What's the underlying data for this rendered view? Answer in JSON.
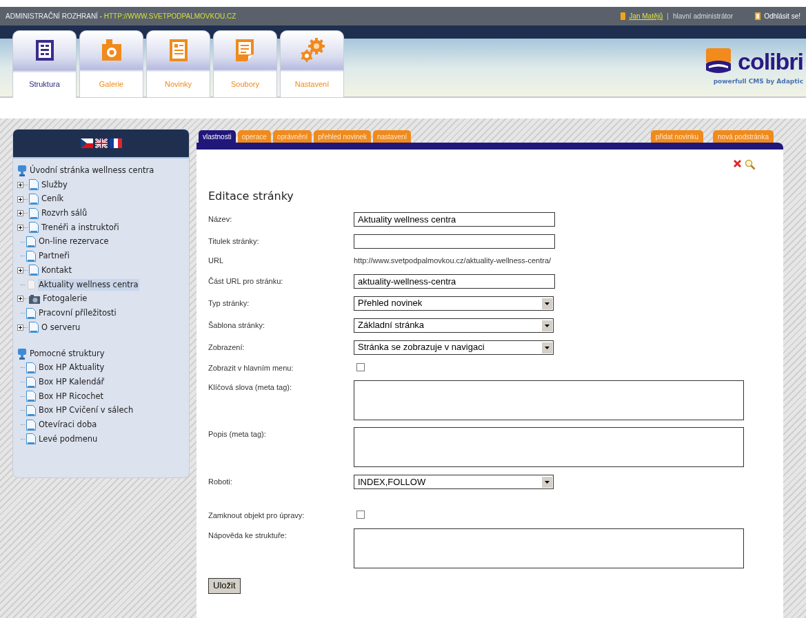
{
  "header": {
    "title": "ADMINISTRAČNÍ ROZHRANÍ - ",
    "site_url": "HTTP://WWW.SVETPODPALMOVKOU.CZ",
    "user": "Jan Matějů",
    "separator": "|",
    "role": "hlavní administrátor",
    "logout": "Odhlásit se!"
  },
  "modules": [
    {
      "label": "Struktura",
      "kind": "structure",
      "selected": true
    },
    {
      "label": "Galerie",
      "kind": "gallery",
      "selected": false
    },
    {
      "label": "Novinky",
      "kind": "news",
      "selected": false
    },
    {
      "label": "Soubory",
      "kind": "files",
      "selected": false
    },
    {
      "label": "Nastavení",
      "kind": "settings",
      "selected": false
    }
  ],
  "logo": {
    "name": "colibri",
    "tagline": "powerfull CMS by Adaptic"
  },
  "languages": [
    {
      "kind": "cz"
    },
    {
      "kind": "uk"
    },
    {
      "kind": "fr"
    }
  ],
  "tree": {
    "sections": [
      {
        "label": "Úvodní stránka wellness centra",
        "children": [
          {
            "label": "Služby",
            "kind": "page",
            "expandable": true,
            "selected": false
          },
          {
            "label": "Ceník",
            "kind": "page",
            "expandable": true,
            "selected": false
          },
          {
            "label": "Rozvrh sálů",
            "kind": "page",
            "expandable": true,
            "selected": false
          },
          {
            "label": "Trenéři a instruktoři",
            "kind": "page",
            "expandable": true,
            "selected": false
          },
          {
            "label": "On-line rezervace",
            "kind": "page",
            "expandable": false,
            "selected": false
          },
          {
            "label": "Partneři",
            "kind": "page",
            "expandable": false,
            "selected": false
          },
          {
            "label": "Kontakt",
            "kind": "page",
            "expandable": true,
            "selected": false
          },
          {
            "label": "Aktuality wellness centra",
            "kind": "news",
            "expandable": false,
            "selected": true
          },
          {
            "label": "Fotogalerie",
            "kind": "gallery",
            "expandable": true,
            "selected": false
          },
          {
            "label": "Pracovní příležitosti",
            "kind": "page",
            "expandable": false,
            "selected": false
          },
          {
            "label": "O serveru",
            "kind": "page",
            "expandable": true,
            "selected": false
          }
        ]
      },
      {
        "label": "Pomocné struktury",
        "children": [
          {
            "label": "Box HP Aktuality",
            "kind": "page",
            "expandable": false,
            "selected": false
          },
          {
            "label": "Box HP Kalendář",
            "kind": "page",
            "expandable": false,
            "selected": false
          },
          {
            "label": "Box HP Ricochet",
            "kind": "page",
            "expandable": false,
            "selected": false
          },
          {
            "label": "Box HP Cvičení v sálech",
            "kind": "page",
            "expandable": false,
            "selected": false
          },
          {
            "label": "Otevíraci doba",
            "kind": "page",
            "expandable": false,
            "selected": false
          },
          {
            "label": "Levé podmenu",
            "kind": "page",
            "expandable": false,
            "selected": false
          }
        ]
      }
    ]
  },
  "tabs": [
    {
      "label": "vlastnosti",
      "selected": true
    },
    {
      "label": "operace",
      "selected": false
    },
    {
      "label": "oprávnění",
      "selected": false
    },
    {
      "label": "přehled novinek",
      "selected": false
    },
    {
      "label": "nastavení",
      "selected": false
    }
  ],
  "actions": [
    "přidat novinku",
    "nová podstránka"
  ],
  "form": {
    "title": "Editace stránky",
    "fields": [
      {
        "kind": "text",
        "label": "Název:",
        "value": "Aktuality wellness centra"
      },
      {
        "kind": "text",
        "label": "Titulek stránky:"
      },
      {
        "kind": "static",
        "label": "URL",
        "value": "http://www.svetpodpalmovkou.cz/aktuality-wellness-centra/"
      },
      {
        "kind": "text",
        "label": "Část URL pro stránku:",
        "value": "aktuality-wellness-centra"
      },
      {
        "kind": "select",
        "label": "Typ stránky:",
        "value": "Přehled novinek"
      },
      {
        "kind": "select",
        "label": "Šablona stránky:",
        "value": "Základní stránka"
      },
      {
        "kind": "select",
        "label": "Zobrazení:",
        "value": "Stránka se zobrazuje v navigaci"
      },
      {
        "kind": "checkbox",
        "label": "Zobrazit v hlavním menu:",
        "checked": false
      },
      {
        "kind": "textarea",
        "label": "Klíčová slova (meta tag):"
      },
      {
        "kind": "textarea",
        "label": "Popis (meta tag):"
      },
      {
        "kind": "select",
        "label": "Roboti:",
        "value": "INDEX,FOLLOW"
      },
      {
        "kind": "checkbox",
        "label": "Zamknout objekt pro úpravy:",
        "checked": false
      },
      {
        "kind": "textarea",
        "label": "Nápověda ke struktuře:"
      }
    ],
    "submit": "Uložit"
  }
}
